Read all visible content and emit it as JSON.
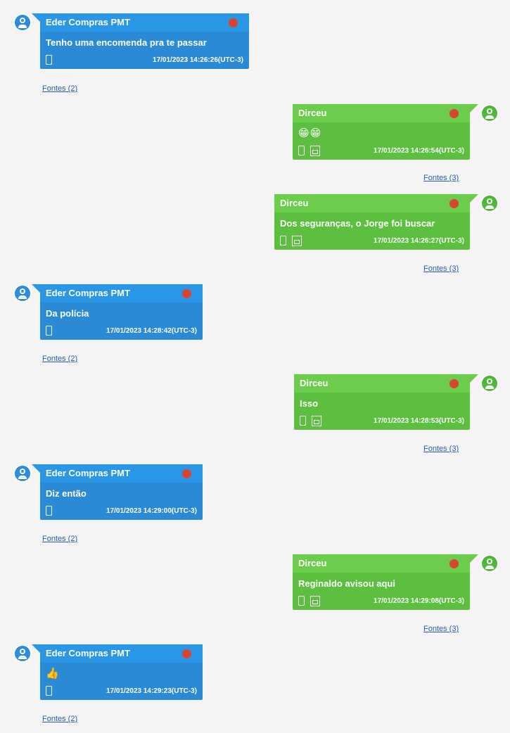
{
  "messages": [
    {
      "sender": "Eder Compras PMT",
      "text": "Tenho uma encomenda pra te passar",
      "timestamp": "17/01/2023 14:26:26(UTC-3)",
      "sources": "Fontes (2)",
      "icon": "phone-icon"
    },
    {
      "sender": "Dirceu",
      "text": "😁😁",
      "timestamp": "17/01/2023 14:26:54(UTC-3)",
      "sources": "Fontes (3)",
      "icon": "phone-icon",
      "icon2": "sim-card-icon"
    },
    {
      "sender": "Dirceu",
      "text": "Dos seguranças, o Jorge foi buscar",
      "timestamp": "17/01/2023 14:26:27(UTC-3)",
      "sources": "Fontes (3)",
      "icon": "phone-icon",
      "icon2": "sim-card-icon"
    },
    {
      "sender": "Eder Compras PMT",
      "text": "Da polícia",
      "timestamp": "17/01/2023 14:28:42(UTC-3)",
      "sources": "Fontes (2)",
      "icon": "phone-icon"
    },
    {
      "sender": "Dirceu",
      "text": "Isso",
      "timestamp": "17/01/2023 14:28:53(UTC-3)",
      "sources": "Fontes (3)",
      "icon": "phone-icon",
      "icon2": "sim-card-icon"
    },
    {
      "sender": "Eder Compras PMT",
      "text": "Diz então",
      "timestamp": "17/01/2023 14:29:00(UTC-3)",
      "sources": "Fontes (2)",
      "icon": "phone-icon"
    },
    {
      "sender": "Dirceu",
      "text": "Reginaldo avisou aqui",
      "timestamp": "17/01/2023 14:29:08(UTC-3)",
      "sources": "Fontes (3)",
      "icon": "phone-icon",
      "icon2": "sim-card-icon"
    },
    {
      "sender": "Eder Compras PMT",
      "text": "👍",
      "timestamp": "17/01/2023 14:29:23(UTC-3)",
      "sources": "Fontes (2)",
      "icon": "phone-icon"
    }
  ]
}
